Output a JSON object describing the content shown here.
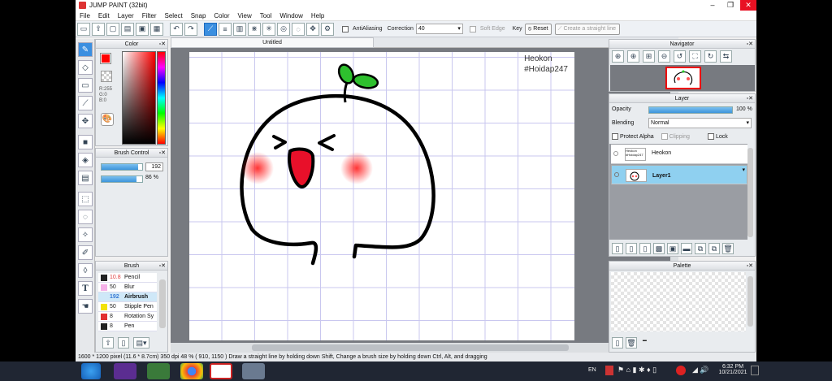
{
  "window": {
    "title": "JUMP PAINT (32bit)"
  },
  "menu": [
    "File",
    "Edit",
    "Layer",
    "Filter",
    "Select",
    "Snap",
    "Color",
    "View",
    "Tool",
    "Window",
    "Help"
  ],
  "toolbar": {
    "antialias_label": "AntiAliasing",
    "correction_label": "Correction",
    "correction_value": "40",
    "soft_edge_label": "Soft Edge",
    "key_label": "Key",
    "reset_label": "Reset",
    "straight_line_label": "Create a straight line"
  },
  "panels": {
    "color": {
      "title": "Color",
      "r": "R:255",
      "g": "G:0",
      "b": "B:0",
      "primary_color": "#ff0000"
    },
    "brush_control": {
      "title": "Brush Control",
      "size": "192",
      "opacity": "86 %",
      "size_fill": 0.9,
      "opacity_fill": 0.86
    },
    "brush": {
      "title": "Brush",
      "items": [
        {
          "size": "10.8",
          "name": "Pencil",
          "color": "#222222",
          "selected": false
        },
        {
          "size": "50",
          "name": "Blur",
          "color": "#f5b0e8",
          "selected": false
        },
        {
          "size": "192",
          "name": "Airbrush",
          "color": "#cfe8f8",
          "selected": true
        },
        {
          "size": "50",
          "name": "Stipple Pen",
          "color": "#f2e20a",
          "selected": false
        },
        {
          "size": "8",
          "name": "Rotation Sy",
          "color": "#e23030",
          "selected": false
        },
        {
          "size": "8",
          "name": "Pen",
          "color": "#222222",
          "selected": false
        }
      ]
    },
    "navigator": {
      "title": "Navigator"
    },
    "layer": {
      "title": "Layer",
      "opacity_label": "Opacity",
      "opacity_value": "100 %",
      "blending_label": "Blending",
      "blending_value": "Normal",
      "protect_alpha_label": "Protect Alpha",
      "clipping_label": "Clipping",
      "lock_label": "Lock",
      "layers": [
        {
          "name": "Heokon",
          "selected": false
        },
        {
          "name": "Layer1",
          "selected": true
        }
      ]
    },
    "palette": {
      "title": "Palette"
    }
  },
  "document": {
    "tab": "Untitled",
    "watermark_line1": "Heokon",
    "watermark_line2": "#Hoidap247"
  },
  "statusbar": {
    "text": "1600 * 1200 pixel   (11.6 * 8.7cm)   350 dpi   48 %   ( 910, 1150 )   Draw a straight line by holding down Shift, Change a brush size by holding down Ctrl, Alt, and dragging"
  },
  "taskbar": {
    "lang": "EN",
    "time": "6:32 PM",
    "date": "10/21/2021"
  }
}
